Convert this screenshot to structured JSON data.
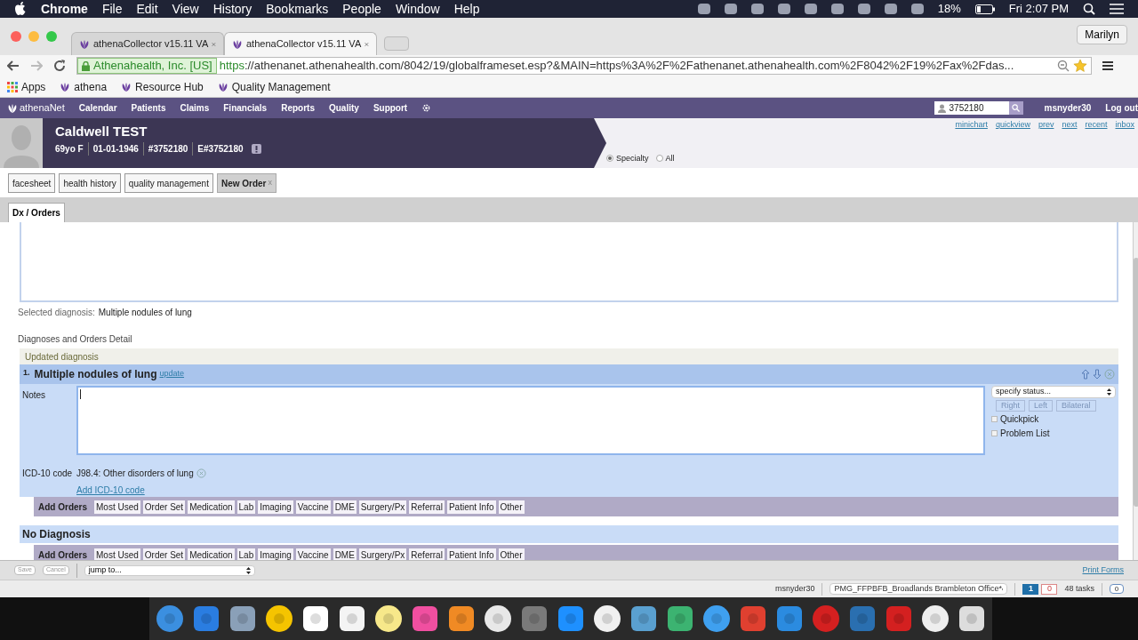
{
  "menubar": {
    "app": "Chrome",
    "menus": [
      "File",
      "Edit",
      "View",
      "History",
      "Bookmarks",
      "People",
      "Window",
      "Help"
    ],
    "battery": "18%",
    "clock": "Fri 2:07 PM"
  },
  "browser": {
    "tabs": [
      {
        "title": "athenaCollector v15.11 VA",
        "selected": false
      },
      {
        "title": "athenaCollector v15.11 VA",
        "selected": true
      }
    ],
    "profile": "Marilyn",
    "org": "Athenahealth, Inc. [US]",
    "scheme": "https",
    "url": "://athenanet.athenahealth.com/8042/19/globalframeset.esp?&MAIN=https%3A%2F%2Fathenanet.athenahealth.com%2F8042%2F19%2Fax%2Fdas...",
    "bookmarks": [
      "Apps",
      "athena",
      "Resource Hub",
      "Quality Management"
    ]
  },
  "app_nav": {
    "logo": "athenaNet",
    "items": [
      "Calendar",
      "Patients",
      "Claims",
      "Financials",
      "Reports",
      "Quality",
      "Support"
    ],
    "search_value": "3752180",
    "user": "msnyder30",
    "logout": "Log out"
  },
  "patient": {
    "name": "Caldwell TEST",
    "details": [
      "69yo F",
      "01-01-1946",
      "#3752180",
      "E#3752180"
    ],
    "links": [
      "minichart",
      "quickview",
      "prev",
      "next",
      "recent",
      "inbox"
    ],
    "filters": [
      {
        "label": "Specialty",
        "selected": true
      },
      {
        "label": "All",
        "selected": false
      }
    ]
  },
  "tabs": [
    {
      "label": "facesheet",
      "selected": false
    },
    {
      "label": "health history",
      "selected": false
    },
    {
      "label": "quality management",
      "selected": false
    },
    {
      "label": "New Order",
      "selected": true,
      "close": "x"
    }
  ],
  "subtabs": [
    {
      "label": "Dx / Orders",
      "selected": true
    }
  ],
  "content": {
    "selected_label": "Selected diagnosis:",
    "selected_value": "Multiple nodules of lung",
    "section_title": "Diagnoses and Orders Detail",
    "banner": "Updated diagnosis",
    "diagnosis": {
      "number": "1.",
      "name": "Multiple nodules of lung",
      "update": "update",
      "notes_label": "Notes",
      "status_placeholder": "specify status...",
      "laterality": [
        "Right",
        "Left",
        "Bilateral"
      ],
      "checks": [
        {
          "label": "Quickpick",
          "checked": false
        },
        {
          "label": "Problem List",
          "checked": false
        }
      ],
      "icd_label": "ICD-10 code",
      "icd_code": "J98.4: Other disorders of lung",
      "add_icd": "Add ICD-10 code"
    },
    "order_rows": [
      {
        "label": "Add Orders",
        "buttons": [
          "Most Used",
          "Order Set",
          "Medication",
          "Lab",
          "Imaging",
          "Vaccine",
          "DME",
          "Surgery/Px",
          "Referral",
          "Patient Info",
          "Other"
        ]
      },
      {
        "heading": "No Diagnosis",
        "label": "Add Orders",
        "buttons": [
          "Most Used",
          "Order Set",
          "Medication",
          "Lab",
          "Imaging",
          "Vaccine",
          "DME",
          "Surgery/Px",
          "Referral",
          "Patient Info",
          "Other"
        ]
      }
    ]
  },
  "bottom_bar": {
    "save": "Save",
    "cancel": "Cancel",
    "jump": "jump to...",
    "print": "Print Forms"
  },
  "status_bar": {
    "user": "msnyder30",
    "office": "PMG_FFPBFB_Broadlands Brambleton Office*",
    "count_a": "1",
    "count_b": "0",
    "tasks": "48 tasks",
    "messages": "0"
  }
}
